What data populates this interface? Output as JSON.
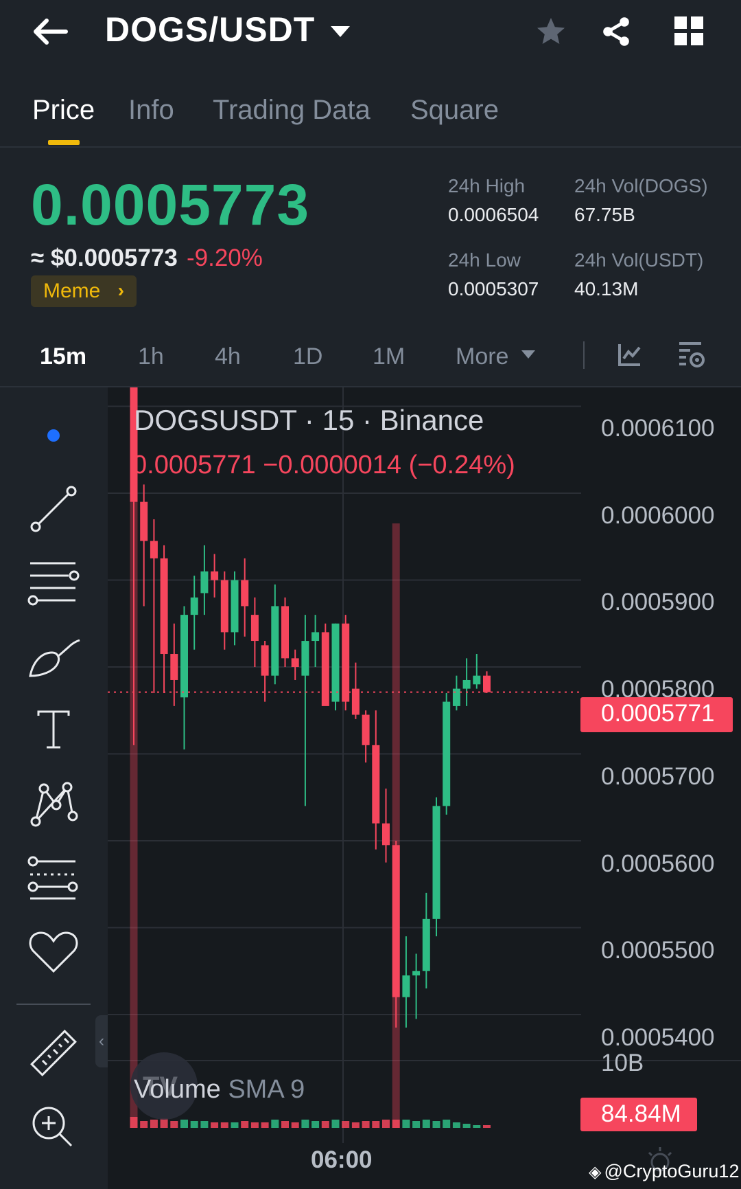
{
  "header": {
    "pair": "DOGS/USDT",
    "icons": [
      "back-arrow-icon",
      "chevron-down-icon",
      "star-icon",
      "share-icon",
      "grid-icon"
    ]
  },
  "tabs": [
    {
      "label": "Price",
      "active": true
    },
    {
      "label": "Info",
      "active": false
    },
    {
      "label": "Trading Data",
      "active": false
    },
    {
      "label": "Square",
      "active": false
    }
  ],
  "ticker": {
    "last_price": "0.0005773",
    "usd_approx": "≈ $0.0005773",
    "change_pct": "-9.20%",
    "tag": "Meme",
    "stats": {
      "high_label": "24h High",
      "high_value": "0.0006504",
      "low_label": "24h Low",
      "low_value": "0.0005307",
      "vol_base_label": "24h Vol(DOGS)",
      "vol_base_value": "67.75B",
      "vol_quote_label": "24h Vol(USDT)",
      "vol_quote_value": "40.13M"
    },
    "colors": {
      "up": "#2ebd85",
      "down": "#f6465d",
      "accent": "#f0b90b"
    }
  },
  "intervals": {
    "items": [
      "15m",
      "1h",
      "4h",
      "1D",
      "1M"
    ],
    "active": "15m",
    "more_label": "More",
    "icons": [
      "indicator-icon",
      "chart-settings-icon"
    ]
  },
  "toolbar": {
    "icons": [
      "crosshair-dot-icon",
      "trend-line-icon",
      "horizontal-lines-icon",
      "brush-icon",
      "text-icon",
      "pattern-icon",
      "fib-icon",
      "heart-icon",
      "ruler-icon",
      "zoom-in-icon"
    ],
    "collapse_label": "‹"
  },
  "chart": {
    "legend_title": "DOGSUSDT · 15 · Binance",
    "legend_ohlc": "0.0005771  −0.0000014 (−0.24%)",
    "current_price_tag": "0.0005771",
    "price_ticks": [
      "0.0006100",
      "0.0006000",
      "0.0005900",
      "0.0005800",
      "0.0005700",
      "0.0005600",
      "0.0005500",
      "0.0005400"
    ],
    "volume_label": "Volume",
    "volume_sma": "SMA 9",
    "volume_axis_label": "10B",
    "volume_tag": "84.84M",
    "time_label": "06:00",
    "tv_logo": "TV"
  },
  "chart_data": {
    "type": "candlestick",
    "symbol": "DOGSUSDT",
    "interval": "15",
    "exchange": "Binance",
    "ylim": [
      0.00053,
      0.00061
    ],
    "candles": [
      {
        "o": 0.000615,
        "h": 0.000615,
        "l": 0.000571,
        "c": 0.000599
      },
      {
        "o": 0.000599,
        "h": 0.000601,
        "l": 0.000587,
        "c": 0.0005945
      },
      {
        "o": 0.0005945,
        "h": 0.000597,
        "l": 0.000577,
        "c": 0.0005925
      },
      {
        "o": 0.0005925,
        "h": 0.000594,
        "l": 0.000577,
        "c": 0.0005815
      },
      {
        "o": 0.0005815,
        "h": 0.000585,
        "l": 0.0005755,
        "c": 0.0005785
      },
      {
        "o": 0.0005765,
        "h": 0.000587,
        "l": 0.0005705,
        "c": 0.000586
      },
      {
        "o": 0.000586,
        "h": 0.0005905,
        "l": 0.000582,
        "c": 0.000588
      },
      {
        "o": 0.0005885,
        "h": 0.000594,
        "l": 0.000586,
        "c": 0.000591
      },
      {
        "o": 0.000591,
        "h": 0.000593,
        "l": 0.000588,
        "c": 0.00059
      },
      {
        "o": 0.00059,
        "h": 0.000591,
        "l": 0.000582,
        "c": 0.000584
      },
      {
        "o": 0.000584,
        "h": 0.000591,
        "l": 0.0005825,
        "c": 0.00059
      },
      {
        "o": 0.00059,
        "h": 0.0005925,
        "l": 0.0005835,
        "c": 0.000587
      },
      {
        "o": 0.000586,
        "h": 0.000588,
        "l": 0.00058,
        "c": 0.000583
      },
      {
        "o": 0.0005825,
        "h": 0.000583,
        "l": 0.000576,
        "c": 0.000579
      },
      {
        "o": 0.000579,
        "h": 0.0005895,
        "l": 0.000578,
        "c": 0.000587
      },
      {
        "o": 0.000587,
        "h": 0.000588,
        "l": 0.00058,
        "c": 0.000581
      },
      {
        "o": 0.000581,
        "h": 0.000582,
        "l": 0.0005785,
        "c": 0.00058
      },
      {
        "o": 0.000579,
        "h": 0.000586,
        "l": 0.000564,
        "c": 0.000583
      },
      {
        "o": 0.000583,
        "h": 0.000586,
        "l": 0.00058,
        "c": 0.000584
      },
      {
        "o": 0.000584,
        "h": 0.000585,
        "l": 0.000576,
        "c": 0.0005755
      },
      {
        "o": 0.000576,
        "h": 0.000585,
        "l": 0.000575,
        "c": 0.000585
      },
      {
        "o": 0.000585,
        "h": 0.000586,
        "l": 0.000575,
        "c": 0.000576
      },
      {
        "o": 0.0005775,
        "h": 0.0005805,
        "l": 0.000574,
        "c": 0.0005745
      },
      {
        "o": 0.0005745,
        "h": 0.000575,
        "l": 0.000569,
        "c": 0.000571
      },
      {
        "o": 0.000571,
        "h": 0.000575,
        "l": 0.000559,
        "c": 0.000562
      },
      {
        "o": 0.000562,
        "h": 0.000566,
        "l": 0.0005575,
        "c": 0.0005595
      },
      {
        "o": 0.0005595,
        "h": 0.00056,
        "l": 0.0005385,
        "c": 0.000542
      },
      {
        "o": 0.000542,
        "h": 0.000549,
        "l": 0.0005385,
        "c": 0.0005445
      },
      {
        "o": 0.0005445,
        "h": 0.000547,
        "l": 0.0005395,
        "c": 0.000545
      },
      {
        "o": 0.000545,
        "h": 0.000554,
        "l": 0.000543,
        "c": 0.000551
      },
      {
        "o": 0.000551,
        "h": 0.000565,
        "l": 0.000549,
        "c": 0.000564
      },
      {
        "o": 0.000564,
        "h": 0.000577,
        "l": 0.000563,
        "c": 0.000576
      },
      {
        "o": 0.0005755,
        "h": 0.000579,
        "l": 0.000575,
        "c": 0.0005775
      },
      {
        "o": 0.0005775,
        "h": 0.000581,
        "l": 0.0005755,
        "c": 0.0005785
      },
      {
        "o": 0.000578,
        "h": 0.0005815,
        "l": 0.0005775,
        "c": 0.000579
      },
      {
        "o": 0.000579,
        "h": 0.0005795,
        "l": 0.000577,
        "c": 0.0005771
      }
    ],
    "volume_unit": "B",
    "volumes": [
      0.8,
      0.5,
      0.6,
      0.7,
      0.5,
      0.6,
      0.5,
      0.5,
      0.4,
      0.4,
      0.4,
      0.5,
      0.4,
      0.4,
      0.6,
      0.5,
      0.4,
      0.6,
      0.5,
      0.5,
      0.6,
      0.5,
      0.4,
      0.5,
      0.5,
      0.6,
      10.0,
      0.6,
      0.5,
      0.6,
      0.5,
      0.6,
      0.4,
      0.3,
      0.2,
      0.1
    ],
    "background_volume_spikes": [
      {
        "index": 0,
        "value": 11.0
      },
      {
        "index": 26,
        "value": 10.0
      }
    ],
    "last_price": 0.0005771,
    "last_volume": "84.84M",
    "x_tick": "06:00",
    "grid": true
  }
}
